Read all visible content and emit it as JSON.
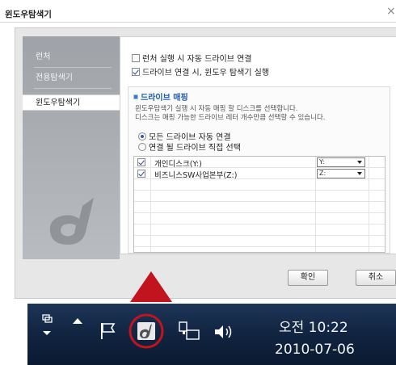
{
  "dialog": {
    "title": "윈도우탐색기",
    "close_glyph": "×"
  },
  "sidebar": {
    "items": [
      {
        "label": "런처"
      },
      {
        "label": "전용탐색기"
      },
      {
        "label": "윈도우탐색기",
        "active": true
      }
    ]
  },
  "options": {
    "auto_connect_on_launch": {
      "label": "런처 실행 시 자동 드라이브 연결",
      "checked": false
    },
    "run_explorer_on_connect": {
      "label": "드라이브 연결 시, 윈도우 탐색기 실행",
      "checked": true
    }
  },
  "mapping": {
    "heading": "드라이브 매핑",
    "desc_line1": "윈도우탐색기 실행 시 자동 매핑 할 디스크를 선택합니다.",
    "desc_line2": "디스크는 매핑 가능한 드라이브 레터 개수만큼 선택할 수 있습니다.",
    "radio_all": {
      "label": "모든 드라이브 자동 연결",
      "selected": true
    },
    "radio_select": {
      "label": "연결 될 드라이브 직접 선택",
      "selected": false
    },
    "drives": [
      {
        "name": "개인디스크(Y:)",
        "checked": true,
        "letter": "Y:"
      },
      {
        "name": "비즈니스SW사업본부(Z:)",
        "checked": true,
        "letter": "Z:"
      }
    ]
  },
  "buttons": {
    "ok": "확인",
    "cancel": "취소"
  },
  "taskbar": {
    "time": "오전 10:22",
    "date": "2010-07-06",
    "highlight_color": "#c1141f"
  }
}
